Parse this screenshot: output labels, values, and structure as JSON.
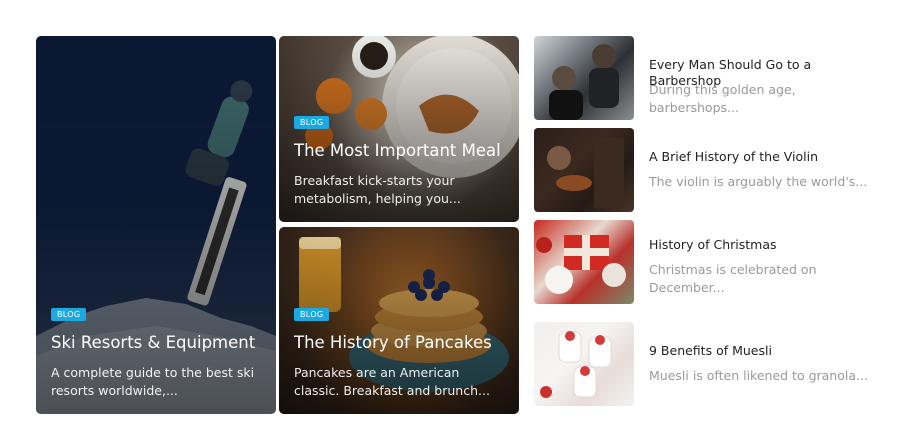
{
  "featured": [
    {
      "id": "ski",
      "badge": "BLOG",
      "title": "Ski Resorts & Equipment",
      "excerpt": "A complete guide to the best ski resorts worldwide,..."
    },
    {
      "id": "meal",
      "badge": "BLOG",
      "title": "The Most Important Meal",
      "excerpt": "Breakfast kick-starts your metabolism, helping you..."
    },
    {
      "id": "pancakes",
      "badge": "BLOG",
      "title": "The History of Pancakes",
      "excerpt": "Pancakes are an American classic. Breakfast and brunch..."
    }
  ],
  "list": [
    {
      "title": "Every Man Should Go to a Barbershop",
      "excerpt": "During this golden age, barbershops..."
    },
    {
      "title": "A Brief History of the Violin",
      "excerpt": "The violin is arguably the world's..."
    },
    {
      "title": "History of Christmas",
      "excerpt": "Christmas is celebrated on December..."
    },
    {
      "title": "9 Benefits of Muesli",
      "excerpt": "Muesli is often likened to granola..."
    }
  ],
  "colors": {
    "badge": "#1aa9e0",
    "list_title": "#222222",
    "list_excerpt": "#9a9a9a"
  }
}
